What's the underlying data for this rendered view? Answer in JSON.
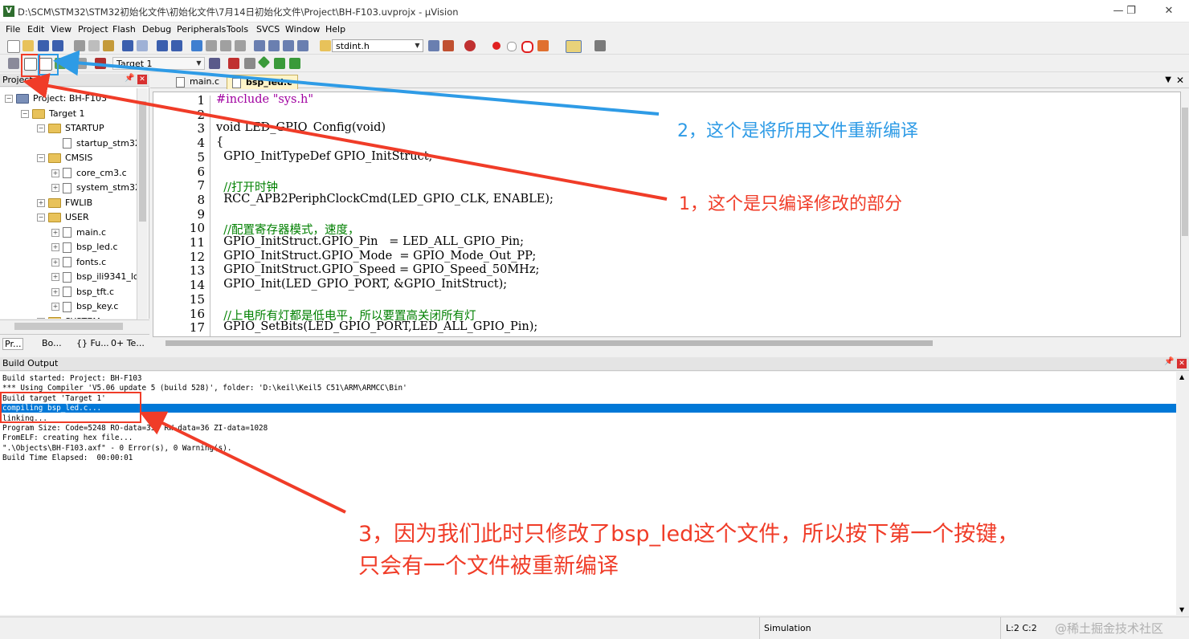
{
  "window": {
    "title": "D:\\SCM\\STM32\\STM32初始化文件\\初始化文件\\7月14日初始化文件\\Project\\BH-F103.uvprojx - µVision",
    "app_icon": "V",
    "controls": [
      "—",
      "❐",
      "✕"
    ]
  },
  "menu": [
    "File",
    "Edit",
    "View",
    "Project",
    "Flash",
    "Debug",
    "Peripherals",
    "Tools",
    "SVCS",
    "Window",
    "Help"
  ],
  "toolbar": {
    "find_combo": "stdint.h",
    "target_combo": "Target 1"
  },
  "project_panel": {
    "title": "Project",
    "tree": [
      {
        "label": "Project: BH-F103",
        "level": 0,
        "kind": "project",
        "exp": "⊟"
      },
      {
        "label": "Target 1",
        "level": 1,
        "kind": "target",
        "exp": "⊟"
      },
      {
        "label": "STARTUP",
        "level": 2,
        "kind": "folder",
        "exp": "⊟"
      },
      {
        "label": "startup_stm32",
        "level": 3,
        "kind": "file",
        "exp": ""
      },
      {
        "label": "CMSIS",
        "level": 2,
        "kind": "folder",
        "exp": "⊟"
      },
      {
        "label": "core_cm3.c",
        "level": 3,
        "kind": "file",
        "exp": "⊞"
      },
      {
        "label": "system_stm32",
        "level": 3,
        "kind": "file",
        "exp": "⊞"
      },
      {
        "label": "FWLIB",
        "level": 2,
        "kind": "folder",
        "exp": "⊞"
      },
      {
        "label": "USER",
        "level": 2,
        "kind": "folder",
        "exp": "⊟"
      },
      {
        "label": "main.c",
        "level": 3,
        "kind": "file",
        "exp": "⊞"
      },
      {
        "label": "bsp_led.c",
        "level": 3,
        "kind": "file",
        "exp": "⊞"
      },
      {
        "label": "fonts.c",
        "level": 3,
        "kind": "file",
        "exp": "⊞"
      },
      {
        "label": "bsp_ili9341_lc",
        "level": 3,
        "kind": "file",
        "exp": "⊞"
      },
      {
        "label": "bsp_tft.c",
        "level": 3,
        "kind": "file",
        "exp": "⊞"
      },
      {
        "label": "bsp_key.c",
        "level": 3,
        "kind": "file",
        "exp": "⊞"
      },
      {
        "label": "SYSTEM",
        "level": 2,
        "kind": "folder",
        "exp": "⊟"
      }
    ],
    "bottom_tabs": [
      "Pr...",
      "Bo...",
      "{} Fu...",
      "0+ Te..."
    ]
  },
  "editor": {
    "tabs": [
      "main.c",
      "bsp_led.c"
    ],
    "active_tab": 1,
    "lines": [
      {
        "n": "1",
        "text": "#include \"sys.h\""
      },
      {
        "n": "2",
        "text": ""
      },
      {
        "n": "3",
        "text": "void LED_GPIO_Config(void)"
      },
      {
        "n": "4",
        "text": "{"
      },
      {
        "n": "5",
        "text": "  GPIO_InitTypeDef GPIO_InitStruct;"
      },
      {
        "n": "6",
        "text": ""
      },
      {
        "n": "7",
        "text": "  //打开时钟"
      },
      {
        "n": "8",
        "text": "  RCC_APB2PeriphClockCmd(LED_GPIO_CLK, ENABLE);"
      },
      {
        "n": "9",
        "text": ""
      },
      {
        "n": "10",
        "text": "  //配置寄存器模式，速度，"
      },
      {
        "n": "11",
        "text": "  GPIO_InitStruct.GPIO_Pin   = LED_ALL_GPIO_Pin;"
      },
      {
        "n": "12",
        "text": "  GPIO_InitStruct.GPIO_Mode  = GPIO_Mode_Out_PP;"
      },
      {
        "n": "13",
        "text": "  GPIO_InitStruct.GPIO_Speed = GPIO_Speed_50MHz;"
      },
      {
        "n": "14",
        "text": "  GPIO_Init(LED_GPIO_PORT, &GPIO_InitStruct);"
      },
      {
        "n": "15",
        "text": ""
      },
      {
        "n": "16",
        "text": "  //上电所有灯都是低电平，所以要置高关闭所有灯"
      },
      {
        "n": "17",
        "text": "  GPIO_SetBits(LED_GPIO_PORT,LED_ALL_GPIO_Pin);"
      }
    ]
  },
  "build_output": {
    "title": "Build Output",
    "lines": [
      "Build started: Project: BH-F103",
      "*** Using Compiler 'V5.06 update 5 (build 528)', folder: 'D:\\keil\\Keil5 C51\\ARM\\ARMCC\\Bin'",
      "Build target 'Target 1'",
      "compiling bsp_led.c...",
      "linking...",
      "Program Size: Code=5248 RO-data=336 RW-data=36 ZI-data=1028",
      "FromELF: creating hex file...",
      "\".\\Objects\\BH-F103.axf\" - 0 Error(s), 0 Warning(s).",
      "Build Time Elapsed:  00:00:01"
    ],
    "highlighted_line": 3
  },
  "status_bar": {
    "mode": "Simulation",
    "position": "L:2 C:2",
    "watermark": "@稀土掘金技术社区"
  },
  "annotations": {
    "note_blue": "2，这个是将所用文件重新编译",
    "note_red_1": "1，这个是只编译修改的部分",
    "note_red_3_line1": "3，因为我们此时只修改了bsp_led这个文件，所以按下第一个按键，",
    "note_red_3_line2": "只会有一个文件被重新编译"
  },
  "colors": {
    "annotation_red": "#f03c28",
    "annotation_blue": "#2e9be6",
    "highlight_blue": "#0078d7",
    "code_comment": "#008000",
    "code_keyword": "#0000c0",
    "code_string": "#a000a0"
  }
}
